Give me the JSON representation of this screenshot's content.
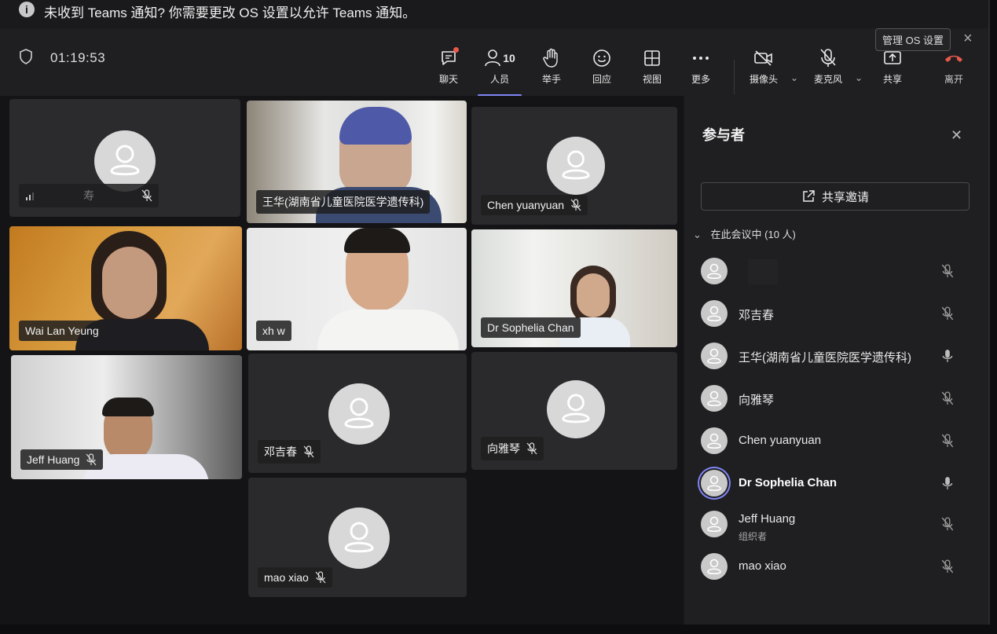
{
  "notification": {
    "message": "未收到 Teams 通知? 你需要更改 OS 设置以允许 Teams 通知。",
    "manage_label": "管理 OS 设置",
    "close_icon": "×"
  },
  "toolbar": {
    "timer": "01:19:53",
    "chat_label": "聊天",
    "people_label": "人员",
    "people_count": "10",
    "raise_hand_label": "举手",
    "react_label": "回应",
    "view_label": "视图",
    "more_label": "更多",
    "camera_label": "摄像头",
    "mic_label": "麦克风",
    "share_label": "共享",
    "leave_label": "离开"
  },
  "tiles": {
    "t1_name": "寿",
    "t2_name": "王华(湖南省儿童医院医学遗传科)",
    "t3_name": "Chen yuanyuan",
    "t4_name": "Wai Lan Yeung",
    "t5_name": "xh w",
    "t6_name": "Dr Sophelia Chan",
    "t7_name": "Jeff Huang",
    "t8_name": "邓吉春",
    "t9_name": "向雅琴",
    "t10_name": "mao xiao"
  },
  "panel": {
    "title": "参与者",
    "share_invite": "共享邀请",
    "section_label": "在此会议中 (10 人)",
    "participants": [
      {
        "name": "",
        "role": ""
      },
      {
        "name": "邓吉春",
        "role": ""
      },
      {
        "name": "王华(湖南省儿童医院医学遗传科)",
        "role": ""
      },
      {
        "name": "向雅琴",
        "role": ""
      },
      {
        "name": "Chen yuanyuan",
        "role": ""
      },
      {
        "name": "Dr Sophelia Chan",
        "role": ""
      },
      {
        "name": "Jeff Huang",
        "role": "组织者"
      },
      {
        "name": "mao xiao",
        "role": ""
      }
    ]
  },
  "colors": {
    "accent": "#7f85f5",
    "leave": "#e8594b",
    "background": "#1c1c1e"
  }
}
